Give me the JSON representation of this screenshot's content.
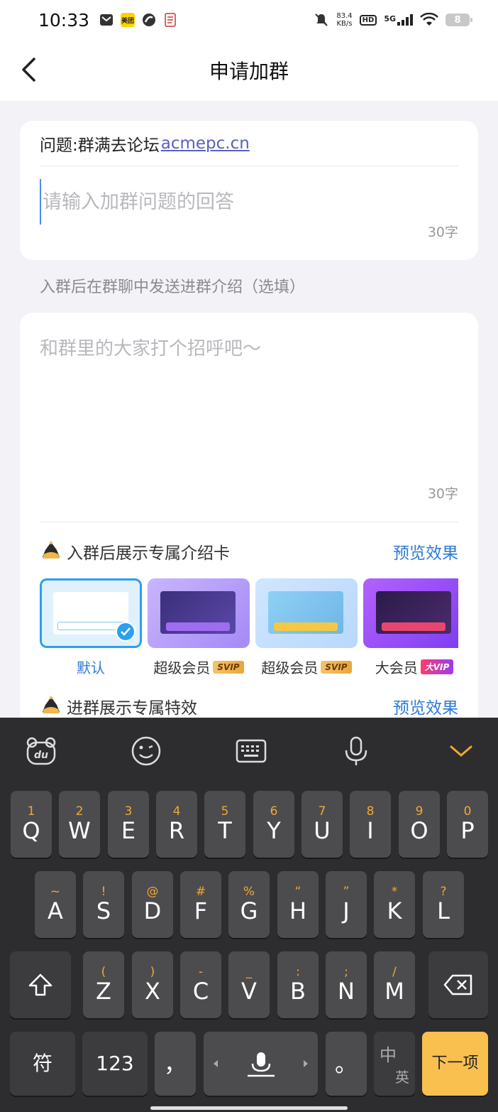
{
  "status_bar": {
    "time": "10:33",
    "speed_value": "83.4",
    "speed_unit": "KB/s",
    "hd": "HD",
    "network": "5G",
    "battery": "8",
    "app_icon_meituan": "美团"
  },
  "nav": {
    "title": "申请加群"
  },
  "question": {
    "prefix": "问题:群满去论坛",
    "link": "acmepc.cn",
    "answer_placeholder": "请输入加群问题的回答",
    "answer_counter": "30字"
  },
  "intro": {
    "label": "入群后在群聊中发送进群介绍（选填）",
    "placeholder": "和群里的大家打个招呼吧～",
    "counter": "30字"
  },
  "intro_card_section": {
    "title": "入群后展示专属介绍卡",
    "preview": "预览效果",
    "templates": [
      {
        "label": "默认",
        "tag": ""
      },
      {
        "label": "超级会员",
        "tag": "SVIP"
      },
      {
        "label": "超级会员",
        "tag": "SVIP"
      },
      {
        "label": "大会员",
        "tag": "大VIP"
      }
    ]
  },
  "effect_section": {
    "title": "进群展示专属特效",
    "preview": "预览效果"
  },
  "keyboard": {
    "row1": [
      {
        "sub": "1",
        "main": "Q"
      },
      {
        "sub": "2",
        "main": "W"
      },
      {
        "sub": "3",
        "main": "E"
      },
      {
        "sub": "4",
        "main": "R"
      },
      {
        "sub": "5",
        "main": "T"
      },
      {
        "sub": "6",
        "main": "Y"
      },
      {
        "sub": "7",
        "main": "U"
      },
      {
        "sub": "8",
        "main": "I"
      },
      {
        "sub": "9",
        "main": "O"
      },
      {
        "sub": "0",
        "main": "P"
      }
    ],
    "row2": [
      {
        "sub": "~",
        "main": "A"
      },
      {
        "sub": "!",
        "main": "S"
      },
      {
        "sub": "@",
        "main": "D"
      },
      {
        "sub": "#",
        "main": "F"
      },
      {
        "sub": "%",
        "main": "G"
      },
      {
        "sub": "“",
        "main": "H"
      },
      {
        "sub": "”",
        "main": "J"
      },
      {
        "sub": "*",
        "main": "K"
      },
      {
        "sub": "?",
        "main": "L"
      }
    ],
    "row3": [
      {
        "sub": "(",
        "main": "Z"
      },
      {
        "sub": ")",
        "main": "X"
      },
      {
        "sub": "-",
        "main": "C"
      },
      {
        "sub": "_",
        "main": "V"
      },
      {
        "sub": ":",
        "main": "B"
      },
      {
        "sub": ";",
        "main": "N"
      },
      {
        "sub": "/",
        "main": "M"
      }
    ],
    "symbol_key": "符",
    "number_key": "123",
    "comma_key": "，",
    "period_key": "。",
    "lang_key_top": "中",
    "lang_key_bottom": "英",
    "enter_key": "下一项"
  }
}
